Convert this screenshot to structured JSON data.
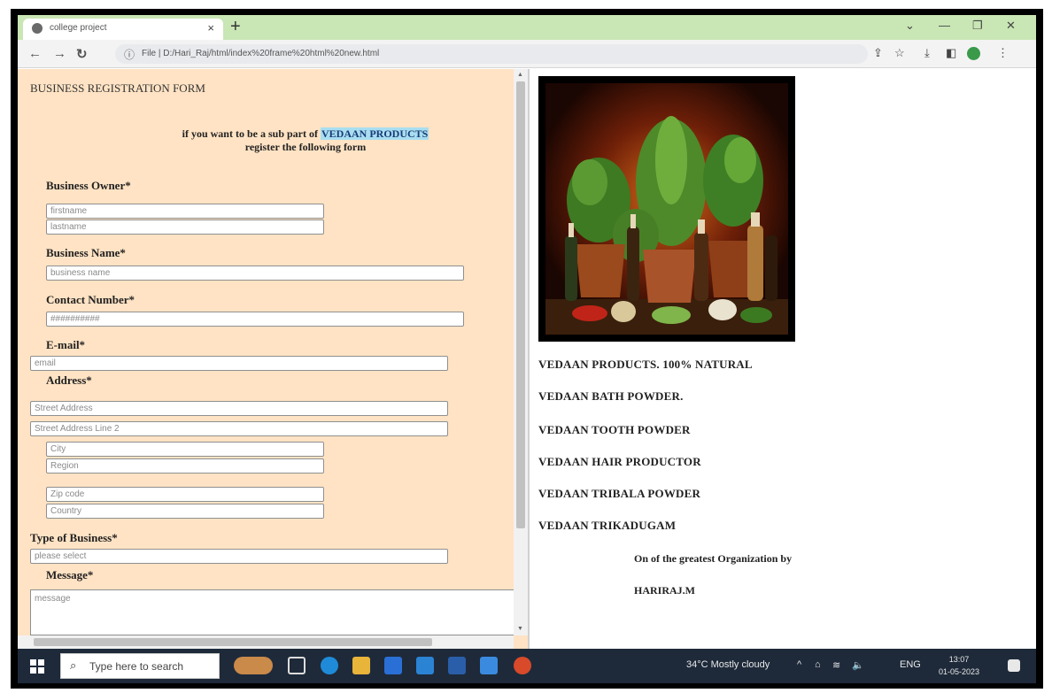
{
  "browser": {
    "tab_title": "college project",
    "tab_close": "×",
    "new_tab": "+",
    "url": "File | D:/Hari_Raj/html/index%20frame%20html%20new.html",
    "info": "ⓘ"
  },
  "form": {
    "title": "BUSINESS REGISTRATION FORM",
    "intro_prefix": "if you want to be a sub part of ",
    "intro_brand": "VEDAAN PRODUCTS",
    "intro_suffix": "register the following form",
    "owner_label": "Business Owner*",
    "firstname_ph": "firstname",
    "lastname_ph": "lastname",
    "business_name_label": "Business Name*",
    "business_name_ph": "business name",
    "contact_label": "Contact Number*",
    "contact_ph": "##########",
    "email_label": "E-mail*",
    "email_ph": "email",
    "address_label": "Address*",
    "street_ph": "Street Address",
    "street2_ph": "Street Address Line 2",
    "city_ph": "City",
    "region_ph": "Region",
    "zip_ph": "Zip code",
    "country_ph": "Country",
    "type_label": "Type of Business*",
    "type_ph": "please select",
    "message_label": "Message*",
    "message_ph": "message"
  },
  "right": {
    "products": [
      "VEDAAN PRODUCTS. 100% NATURAL",
      "VEDAAN BATH POWDER.",
      "VEDAAN TOOTH POWDER",
      "VEDAAN HAIR PRODUCTOR",
      "VEDAAN TRIBALA POWDER",
      "VEDAAN TRIKADUGAM"
    ],
    "org_line": "On of the greatest Organization by",
    "author": "HARIRAJ.M"
  },
  "taskbar": {
    "search_placeholder": "Type here to search",
    "weather": "34°C  Mostly cloudy",
    "lang": "ENG",
    "time": "13:07",
    "date": "01-05-2023"
  },
  "colors": {
    "tabbar": "#c9e6b5",
    "form_bg": "#ffe3c4",
    "brand_highlight": "#a8def0",
    "taskbar": "#1e2a3a"
  }
}
